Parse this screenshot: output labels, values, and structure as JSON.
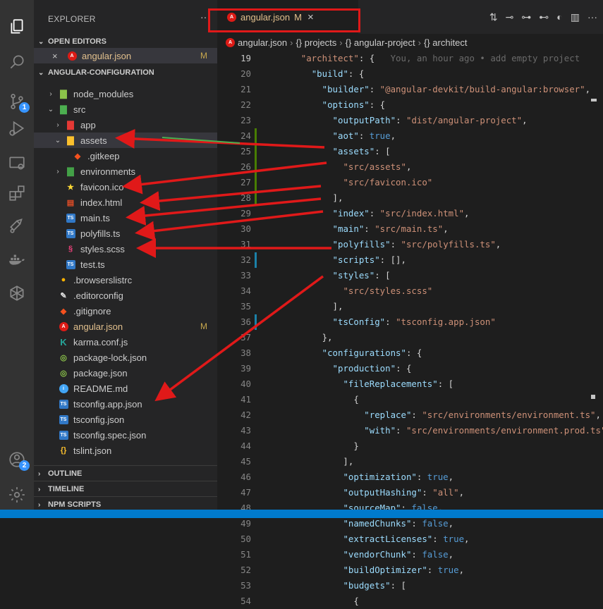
{
  "sidebar": {
    "title": "EXPLORER",
    "more": "···",
    "open_editors_label": "OPEN EDITORS",
    "open_editor_file": "angular.json",
    "open_editor_mod": "M",
    "project_label": "ANGULAR-CONFIGURATION",
    "tree": [
      {
        "name": "node_modules",
        "icon": "folder-node-icon",
        "mod": ""
      },
      {
        "name": "src",
        "icon": "folder-src-icon",
        "mod": ""
      },
      {
        "name": "app",
        "icon": "folder-app-icon",
        "mod": ""
      },
      {
        "name": "assets",
        "icon": "folder-assets-icon",
        "mod": ""
      },
      {
        "name": ".gitkeep",
        "icon": "git-icon",
        "mod": ""
      },
      {
        "name": "environments",
        "icon": "folder-env-icon",
        "mod": ""
      },
      {
        "name": "favicon.ico",
        "icon": "star-icon",
        "mod": ""
      },
      {
        "name": "index.html",
        "icon": "html-icon",
        "mod": ""
      },
      {
        "name": "main.ts",
        "icon": "ts-icon",
        "mod": ""
      },
      {
        "name": "polyfills.ts",
        "icon": "ts-icon",
        "mod": ""
      },
      {
        "name": "styles.scss",
        "icon": "sass-icon",
        "mod": ""
      },
      {
        "name": "test.ts",
        "icon": "ts-icon",
        "mod": ""
      },
      {
        "name": ".browserslistrc",
        "icon": "browserslist-icon",
        "mod": ""
      },
      {
        "name": ".editorconfig",
        "icon": "editorconfig-icon",
        "mod": ""
      },
      {
        "name": ".gitignore",
        "icon": "git-icon",
        "mod": ""
      },
      {
        "name": "angular.json",
        "icon": "angular-icon",
        "mod": "M"
      },
      {
        "name": "karma.conf.js",
        "icon": "karma-icon",
        "mod": ""
      },
      {
        "name": "package-lock.json",
        "icon": "npm-icon",
        "mod": ""
      },
      {
        "name": "package.json",
        "icon": "npm-icon",
        "mod": ""
      },
      {
        "name": "README.md",
        "icon": "info-icon",
        "mod": ""
      },
      {
        "name": "tsconfig.app.json",
        "icon": "tsconfig-icon",
        "mod": ""
      },
      {
        "name": "tsconfig.json",
        "icon": "tsconfig-icon",
        "mod": ""
      },
      {
        "name": "tsconfig.spec.json",
        "icon": "tsconfig-icon",
        "mod": ""
      },
      {
        "name": "tslint.json",
        "icon": "json-icon",
        "mod": ""
      }
    ],
    "outline_label": "OUTLINE",
    "timeline_label": "TIMELINE",
    "npm_label": "NPM SCRIPTS",
    "source_control_badge": "1",
    "accounts_badge": "2"
  },
  "editor": {
    "tab_label": "angular.json",
    "tab_mod": "M",
    "tab_close": "×",
    "breadcrumb": [
      "angular.json",
      "{} projects",
      "{} angular-project",
      "{} architect"
    ],
    "blame": "You, an hour ago • add empty project",
    "lines": [
      {
        "n": "19",
        "html": "<span class='s'>\"architect\"</span>: {"
      },
      {
        "n": "20",
        "html": "  <span class='k'>\"build\"</span>: {"
      },
      {
        "n": "21",
        "html": "    <span class='k'>\"builder\"</span>: <span class='s'>\"@angular-devkit/build-angular:browser\"</span>,"
      },
      {
        "n": "22",
        "html": "    <span class='k'>\"options\"</span>: {"
      },
      {
        "n": "23",
        "html": "      <span class='k'>\"outputPath\"</span>: <span class='s'>\"dist/angular-project\"</span>,"
      },
      {
        "n": "24",
        "html": "      <span class='k'>\"aot\"</span>: <span class='b'>true</span>,"
      },
      {
        "n": "25",
        "html": "      <span class='k'>\"assets\"</span>: ["
      },
      {
        "n": "26",
        "html": "        <span class='s'>\"src/assets\"</span>,"
      },
      {
        "n": "27",
        "html": "        <span class='s'>\"src/favicon.ico\"</span>"
      },
      {
        "n": "28",
        "html": "      ],"
      },
      {
        "n": "29",
        "html": "      <span class='k'>\"index\"</span>: <span class='s'>\"src/index.html\"</span>,"
      },
      {
        "n": "30",
        "html": "      <span class='k'>\"main\"</span>: <span class='s'>\"src/main.ts\"</span>,"
      },
      {
        "n": "31",
        "html": "      <span class='k'>\"polyfills\"</span>: <span class='s'>\"src/polyfills.ts\"</span>,"
      },
      {
        "n": "32",
        "html": "      <span class='k'>\"scripts\"</span>: [],"
      },
      {
        "n": "33",
        "html": "      <span class='k'>\"styles\"</span>: ["
      },
      {
        "n": "34",
        "html": "        <span class='s'>\"src/styles.scss\"</span>"
      },
      {
        "n": "35",
        "html": "      ],"
      },
      {
        "n": "36",
        "html": "      <span class='k'>\"tsConfig\"</span>: <span class='s'>\"tsconfig.app.json\"</span>"
      },
      {
        "n": "37",
        "html": "    },"
      },
      {
        "n": "38",
        "html": "    <span class='k'>\"configurations\"</span>: {"
      },
      {
        "n": "39",
        "html": "      <span class='k'>\"production\"</span>: {"
      },
      {
        "n": "40",
        "html": "        <span class='k'>\"fileReplacements\"</span>: ["
      },
      {
        "n": "41",
        "html": "          {"
      },
      {
        "n": "42",
        "html": "            <span class='k'>\"replace\"</span>: <span class='s'>\"src/environments/environment.ts\"</span>,"
      },
      {
        "n": "43",
        "html": "            <span class='k'>\"with\"</span>: <span class='s'>\"src/environments/environment.prod.ts\"</span>"
      },
      {
        "n": "44",
        "html": "          }"
      },
      {
        "n": "45",
        "html": "        ],"
      },
      {
        "n": "46",
        "html": "        <span class='k'>\"optimization\"</span>: <span class='b'>true</span>,"
      },
      {
        "n": "47",
        "html": "        <span class='k'>\"outputHashing\"</span>: <span class='s'>\"all\"</span>,"
      },
      {
        "n": "48",
        "html": "        <span class='k'>\"sourceMap\"</span>: <span class='b'>false</span>,"
      },
      {
        "n": "49",
        "html": "        <span class='k'>\"namedChunks\"</span>: <span class='b'>false</span>,"
      },
      {
        "n": "50",
        "html": "        <span class='k'>\"extractLicenses\"</span>: <span class='b'>true</span>,"
      },
      {
        "n": "51",
        "html": "        <span class='k'>\"vendorChunk\"</span>: <span class='b'>false</span>,"
      },
      {
        "n": "52",
        "html": "        <span class='k'>\"buildOptimizer\"</span>: <span class='b'>true</span>,"
      },
      {
        "n": "53",
        "html": "        <span class='k'>\"budgets\"</span>: ["
      },
      {
        "n": "54",
        "html": "          {"
      }
    ]
  },
  "colors": {
    "accent": "#007acc",
    "highlight_box": "#e01919",
    "arrow": "#e01919",
    "modified": "#e2c08d"
  }
}
